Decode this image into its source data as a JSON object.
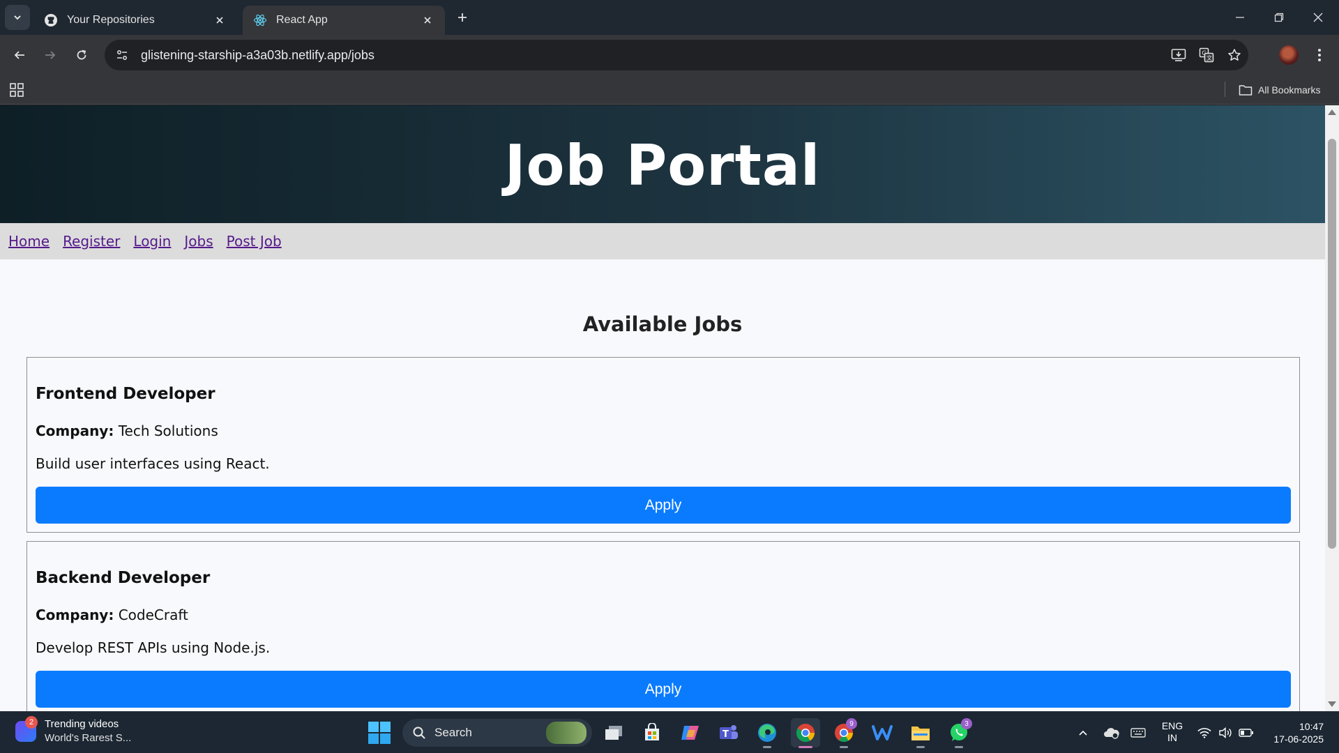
{
  "browser": {
    "tabs": [
      {
        "title": "Your Repositories",
        "icon": "github-icon",
        "active": false
      },
      {
        "title": "React App",
        "icon": "react-icon",
        "active": true
      }
    ],
    "url": "glistening-starship-a3a03b.netlify.app/jobs",
    "bookmarks_label": "All Bookmarks"
  },
  "page": {
    "site_title": "Job Portal",
    "nav": [
      "Home",
      "Register",
      "Login",
      "Jobs",
      "Post Job"
    ],
    "section_title": "Available Jobs",
    "company_label": "Company:",
    "jobs": [
      {
        "title": "Frontend Developer",
        "company": "Tech Solutions",
        "description": "Build user interfaces using React.",
        "button": "Apply"
      },
      {
        "title": "Backend Developer",
        "company": "CodeCraft",
        "description": "Develop REST APIs using Node.js.",
        "button": "Apply"
      }
    ],
    "colors": {
      "header_start": "#0e1f26",
      "header_end": "#2c5364",
      "nav_bg": "#dcdcdc",
      "link": "#551a8b",
      "button": "#0a7bff"
    }
  },
  "taskbar": {
    "widget": {
      "title": "Trending videos",
      "subtitle": "World's Rarest S...",
      "badge": "2"
    },
    "search_placeholder": "Search",
    "apps": [
      {
        "name": "task-view",
        "badge": ""
      },
      {
        "name": "microsoft-store",
        "badge": ""
      },
      {
        "name": "copilot",
        "badge": ""
      },
      {
        "name": "teams",
        "badge": ""
      },
      {
        "name": "edge",
        "badge": ""
      },
      {
        "name": "chrome",
        "badge": ""
      },
      {
        "name": "chrome-profile",
        "badge": "9"
      },
      {
        "name": "webex",
        "badge": ""
      },
      {
        "name": "file-explorer",
        "badge": ""
      },
      {
        "name": "whatsapp",
        "badge": "3"
      }
    ],
    "lang_1": "ENG",
    "lang_2": "IN",
    "time": "10:47",
    "date": "17-06-2025"
  }
}
